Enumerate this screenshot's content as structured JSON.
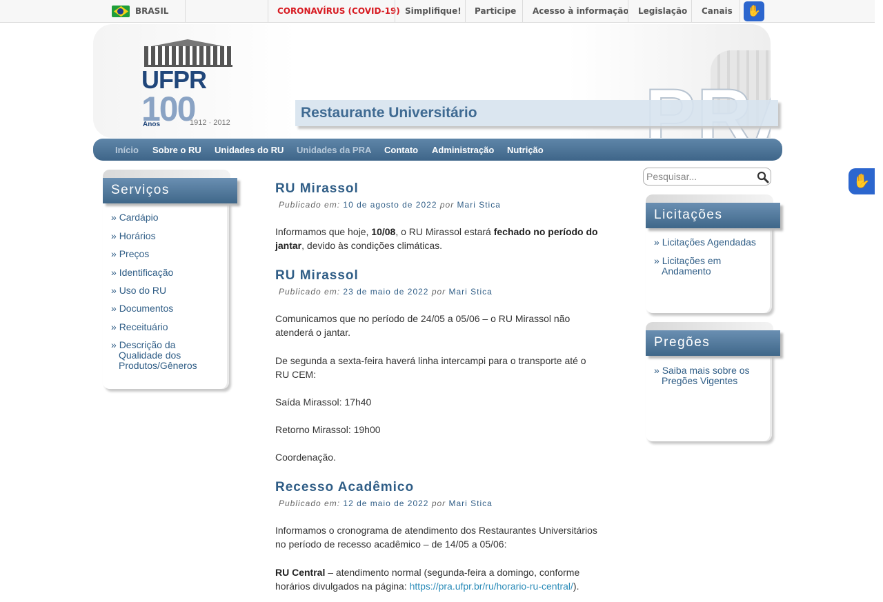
{
  "gov_bar": {
    "brasil_label": "BRASIL",
    "links": [
      "CORONAVÍRUS (COVID-19)",
      "Simplifique!",
      "Participe",
      "Acesso à informação",
      "Legislação",
      "Canais"
    ]
  },
  "header": {
    "logo": {
      "name": "UFPR",
      "hundred": "100",
      "anos": "Anos",
      "years": "1912 · 2012"
    },
    "pra": "PRA",
    "site_title": "Restaurante Universitário"
  },
  "nav": [
    "Início",
    "Sobre o RU",
    "Unidades do RU",
    "Unidades da PRA",
    "Contato",
    "Administração",
    "Nutrição"
  ],
  "services": {
    "title": "Serviços",
    "items": [
      "Cardápio",
      "Horários",
      "Preços",
      "Identificação",
      "Uso do RU",
      "Documentos",
      "Receituário",
      "Descrição da Qualidade dos Produtos/Gêneros"
    ]
  },
  "search": {
    "placeholder": "Pesquisar..."
  },
  "licitacoes": {
    "title": "Licitações",
    "items": [
      "Licitações Agendadas",
      "Licitações em Andamento"
    ]
  },
  "pregoes": {
    "title": "Pregões",
    "items": [
      "Saiba mais sobre os Pregões Vigentes"
    ]
  },
  "posts": [
    {
      "title": "RU Mirassol",
      "meta_label": "Publicado em:",
      "date": "10 de agosto de 2022",
      "por": "por",
      "author": "Mari Stica",
      "p1_a": "Informamos que hoje, ",
      "p1_b": "10/08",
      "p1_c": ", o RU Mirassol estará ",
      "p1_d": "fechado no período do jantar",
      "p1_e": ", devido às condições climáticas."
    },
    {
      "title": "RU Mirassol",
      "meta_label": "Publicado em:",
      "date": "23 de maio de 2022",
      "por": "por",
      "author": "Mari Stica",
      "p1": "Comunicamos que no período de 24/05 a 05/06 – o RU Mirassol não atenderá o jantar.",
      "p2": "De segunda a sexta-feira haverá linha intercampi para o transporte até o RU CEM:",
      "p3": "Saída Mirassol: 17h40",
      "p4": "Retorno Mirassol: 19h00",
      "p5": "Coordenação."
    },
    {
      "title": "Recesso Acadêmico",
      "meta_label": "Publicado em:",
      "date": "12 de maio de 2022",
      "por": "por",
      "author": "Mari Stica",
      "p1": "Informamos o cronograma de atendimento dos Restaurantes Universitários no período de recesso acadêmico – de 14/05 a 05/06:",
      "p2_bold": "RU Central",
      "p2_text": " – atendimento normal (segunda-feira a domingo, conforme horários divulgados na página: ",
      "p2_link": "https://pra.ufpr.br/ru/horario-ru-central/",
      "p2_end": ")."
    }
  ]
}
